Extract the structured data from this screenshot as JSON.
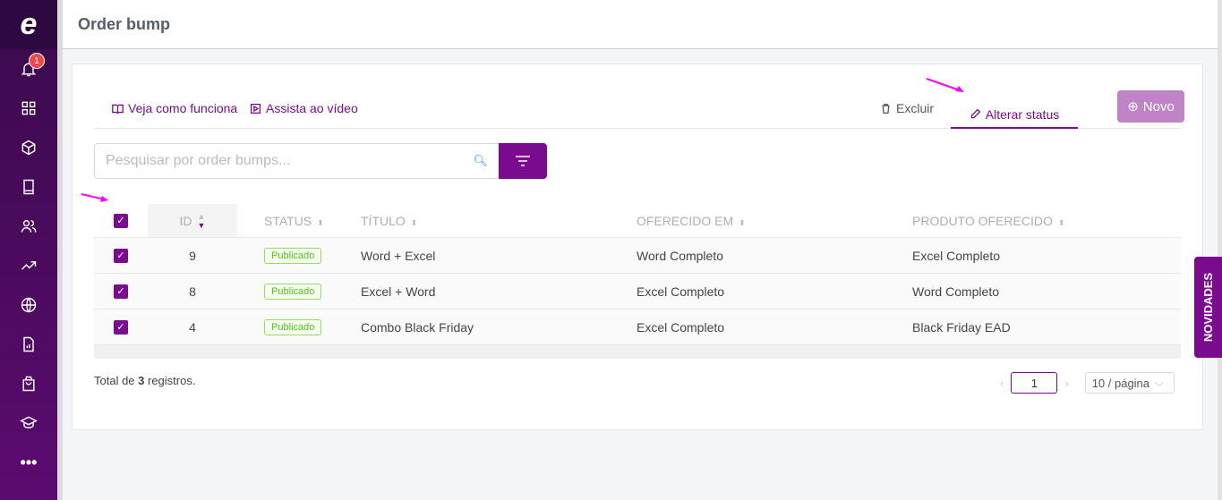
{
  "header": {
    "title": "Order bump"
  },
  "sidebar": {
    "notification_count": "1",
    "logo": "e"
  },
  "toolbar": {
    "how_it_works": "Veja como funciona",
    "watch_video": "Assista ao vídeo",
    "delete": "Excluir",
    "change_status": "Alterar status",
    "new": "Novo"
  },
  "search": {
    "placeholder": "Pesquisar por order bumps..."
  },
  "table": {
    "columns": [
      "ID",
      "STATUS",
      "TÍTULO",
      "OFERECIDO EM",
      "PRODUTO OFERECIDO"
    ],
    "rows": [
      {
        "id": "9",
        "status": "Publicado",
        "title": "Word + Excel",
        "offered_in": "Word Completo",
        "product": "Excel Completo"
      },
      {
        "id": "8",
        "status": "Publicado",
        "title": "Excel + Word",
        "offered_in": "Excel Completo",
        "product": "Word Completo"
      },
      {
        "id": "4",
        "status": "Publicado",
        "title": "Combo Black Friday",
        "offered_in": "Excel Completo",
        "product": "Black Friday EAD"
      }
    ]
  },
  "footer": {
    "total_prefix": "Total de ",
    "total_count": "3",
    "total_suffix": " registros.",
    "page": "1",
    "page_size": "10 / página"
  },
  "novidades": "NOVIDADES",
  "colors": {
    "brand": "#7b0b8e",
    "annotation": "#ff00ff"
  }
}
